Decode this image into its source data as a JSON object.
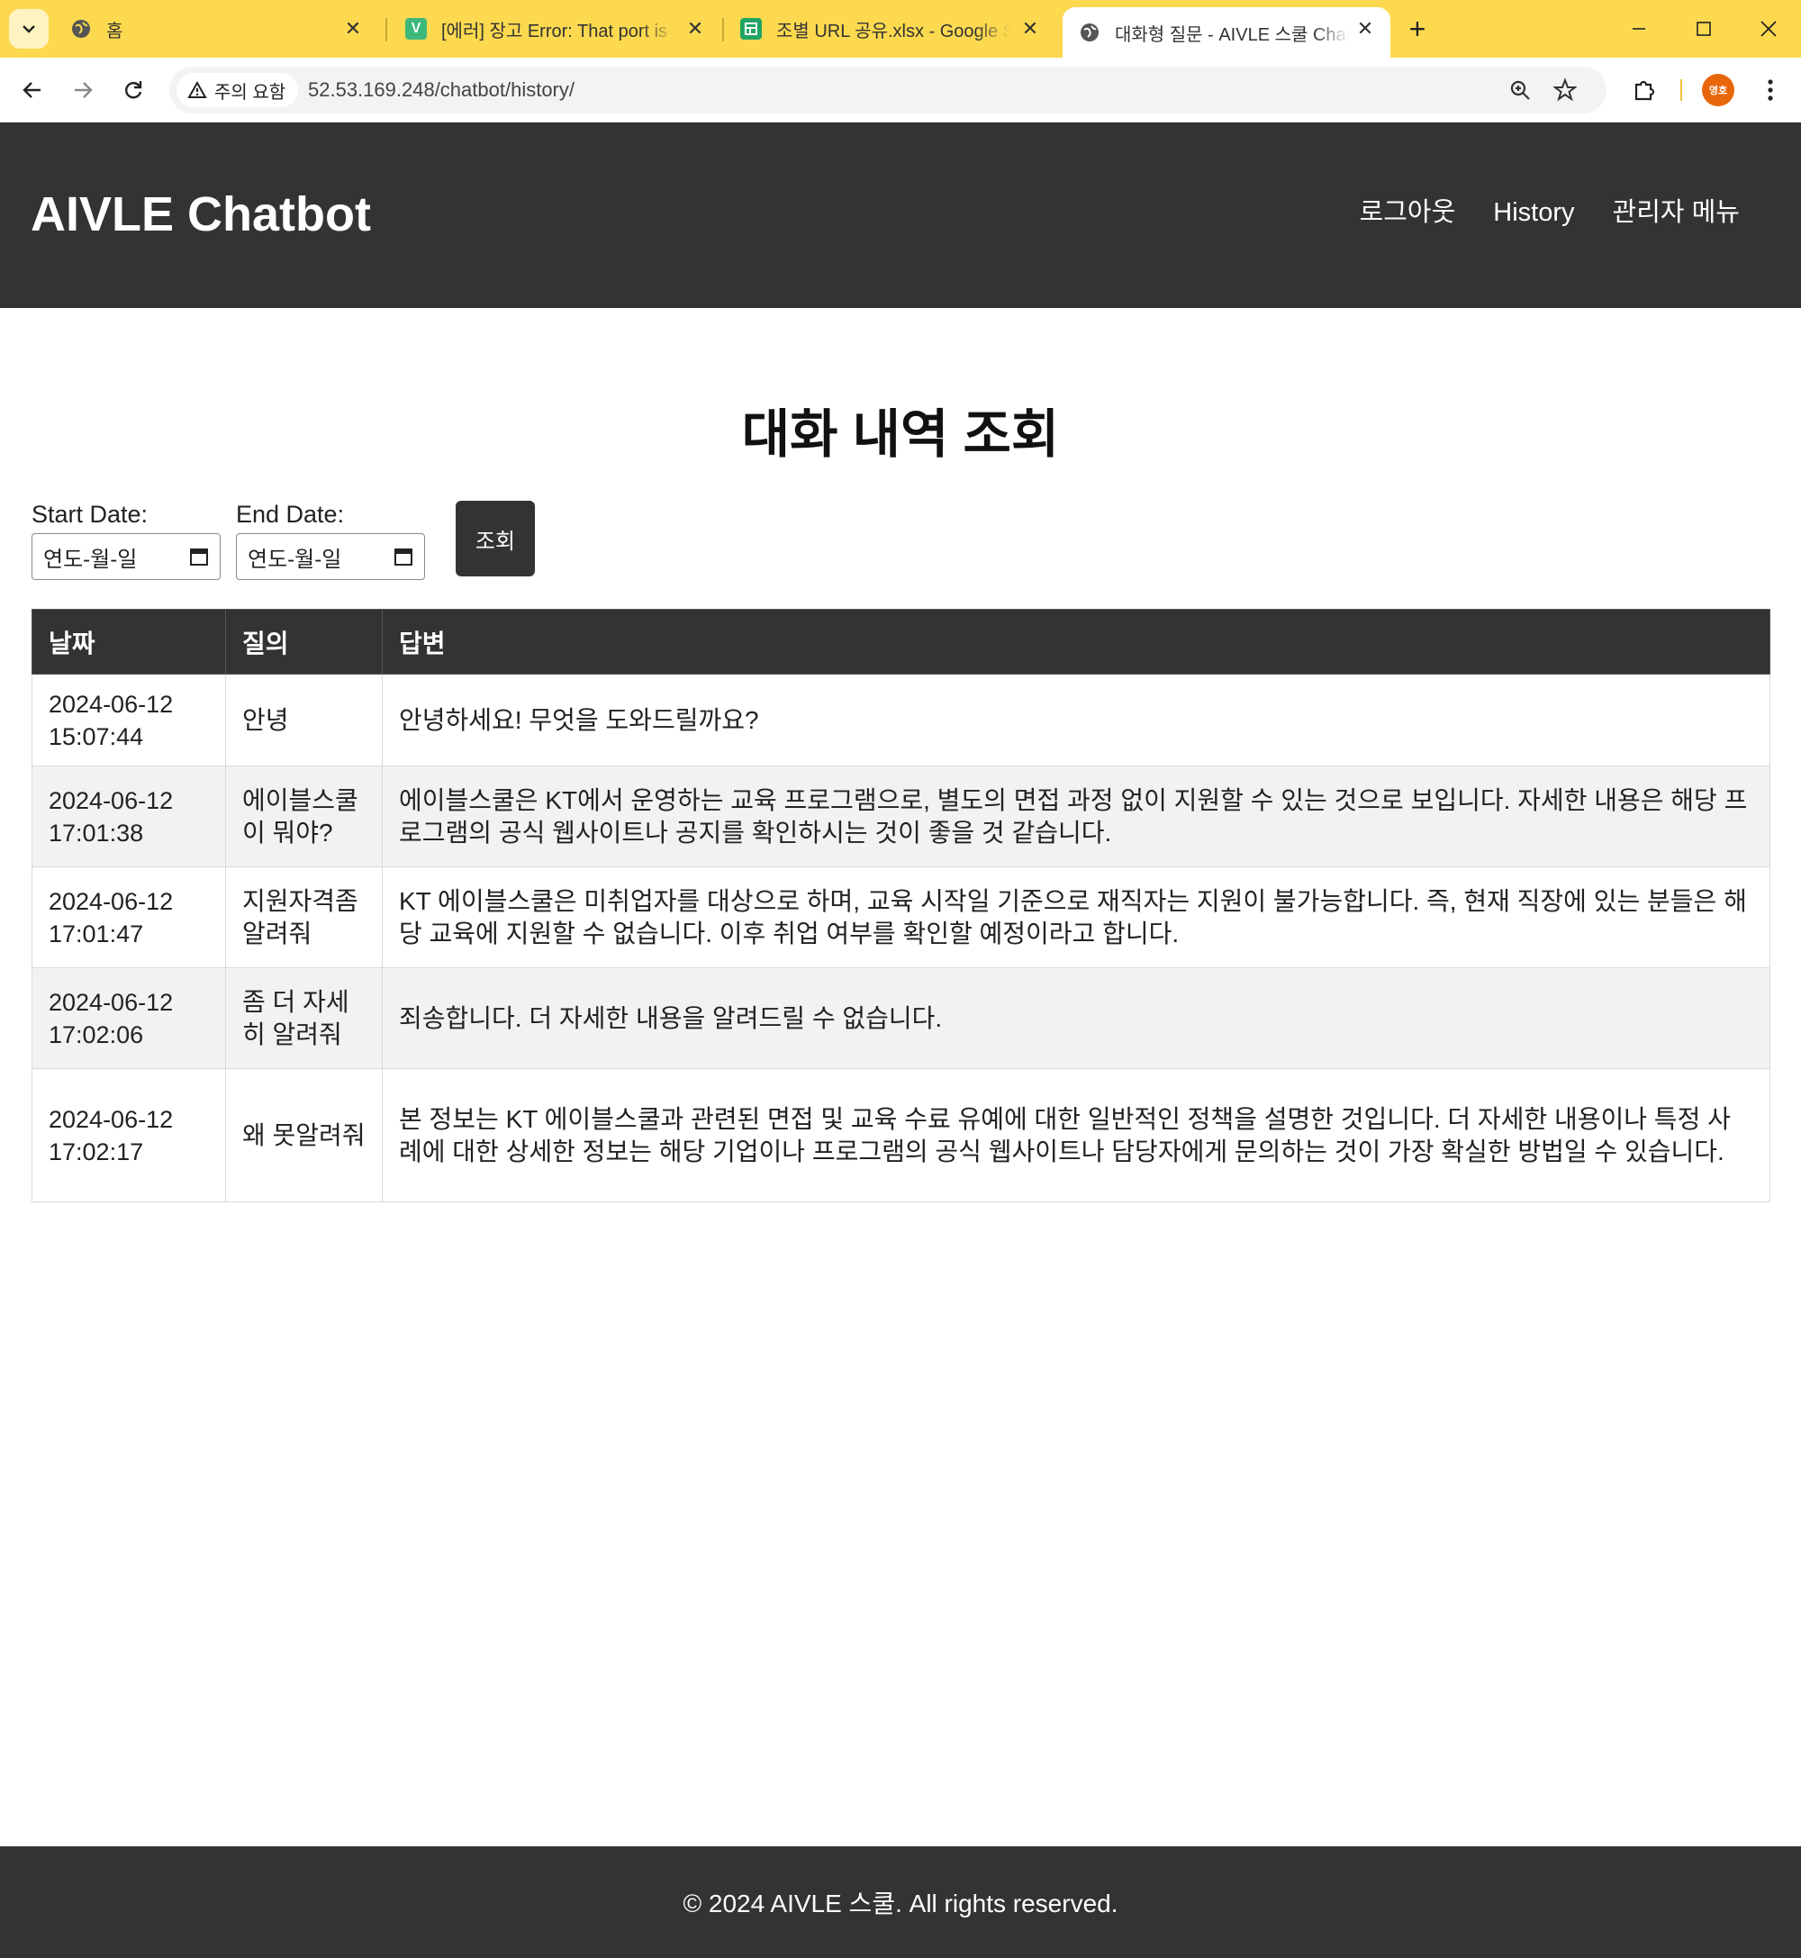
{
  "browser": {
    "tabs": [
      {
        "title": "홈",
        "active": false,
        "favicon": "globe-icon"
      },
      {
        "title": "[에러] 장고 Error: That port is already in use",
        "active": false,
        "favicon": "v-icon"
      },
      {
        "title": "조별 URL 공유.xlsx - Google Sheets",
        "active": false,
        "favicon": "sheets-icon"
      },
      {
        "title": "대화형 질문 - AIVLE 스쿨 Chatbot",
        "active": true,
        "favicon": "globe-icon"
      }
    ],
    "security_label": "주의 요함",
    "url": "52.53.169.248/chatbot/history/",
    "profile_initials": "영호",
    "accent_color": "#fcd94f"
  },
  "header": {
    "brand": "AIVLE Chatbot",
    "nav": {
      "logout": "로그아웃",
      "history": "History",
      "admin": "관리자 메뉴"
    }
  },
  "main": {
    "title": "대화 내역 조회",
    "filters": {
      "start_label": "Start Date:",
      "end_label": "End Date:",
      "date_placeholder": "연도-월-일",
      "search_button": "조회"
    },
    "table": {
      "columns": [
        "날짜",
        "질의",
        "답변"
      ],
      "rows": [
        {
          "date": "2024-06-12 15:07:44",
          "question": "안녕",
          "answer": "안녕하세요! 무엇을 도와드릴까요?"
        },
        {
          "date": "2024-06-12 17:01:38",
          "question": "에이블스쿨이 뭐야?",
          "answer": "에이블스쿨은 KT에서 운영하는 교육 프로그램으로, 별도의 면접 과정 없이 지원할 수 있는 것으로 보입니다. 자세한 내용은 해당 프로그램의 공식 웹사이트나 공지를 확인하시는 것이 좋을 것 같습니다."
        },
        {
          "date": "2024-06-12 17:01:47",
          "question": "지원자격좀 알려줘",
          "answer": "KT 에이블스쿨은 미취업자를 대상으로 하며, 교육 시작일 기준으로 재직자는 지원이 불가능합니다. 즉, 현재 직장에 있는 분들은 해당 교육에 지원할 수 없습니다. 이후 취업 여부를 확인할 예정이라고 합니다."
        },
        {
          "date": "2024-06-12 17:02:06",
          "question": "좀 더 자세히 알려줘",
          "answer": "죄송합니다. 더 자세한 내용을 알려드릴 수 없습니다."
        },
        {
          "date": "2024-06-12 17:02:17",
          "question": "왜 못알려줘",
          "answer": "본 정보는 KT 에이블스쿨과 관련된 면접 및 교육 수료 유예에 대한 일반적인 정책을 설명한 것입니다. 더 자세한 내용이나 특정 사례에 대한 상세한 정보는 해당 기업이나 프로그램의 공식 웹사이트나 담당자에게 문의하는 것이 가장 확실한 방법일 수 있습니다."
        }
      ]
    }
  },
  "footer": {
    "text": "© 2024 AIVLE 스쿨. All rights reserved."
  }
}
